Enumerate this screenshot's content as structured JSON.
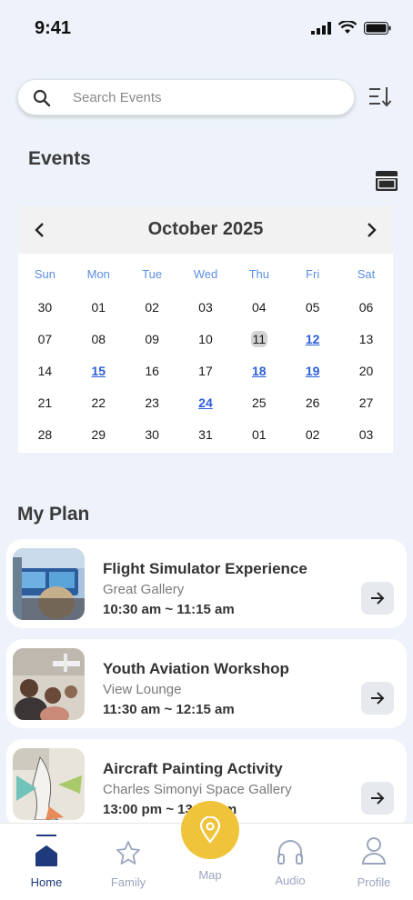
{
  "status": {
    "time": "9:41"
  },
  "search": {
    "placeholder": "Search Events",
    "value": ""
  },
  "events_section": {
    "title": "Events"
  },
  "calendar": {
    "month_label": "October 2025",
    "weekdays": [
      "Sun",
      "Mon",
      "Tue",
      "Wed",
      "Thu",
      "Fri",
      "Sat"
    ],
    "weeks": [
      [
        "30",
        "01",
        "02",
        "03",
        "04",
        "05",
        "06"
      ],
      [
        "07",
        "08",
        "09",
        "10",
        "11",
        "12",
        "13"
      ],
      [
        "14",
        "15",
        "16",
        "17",
        "18",
        "19",
        "20"
      ],
      [
        "21",
        "22",
        "23",
        "24",
        "25",
        "26",
        "27"
      ],
      [
        "28",
        "29",
        "30",
        "31",
        "01",
        "02",
        "03"
      ]
    ],
    "today": "11",
    "event_days": [
      "12",
      "15",
      "18",
      "19",
      "24"
    ]
  },
  "my_plan": {
    "title": "My Plan",
    "items": [
      {
        "name": "Flight Simulator Experience",
        "location": "Great Gallery",
        "time": "10:30 am ~ 11:15 am"
      },
      {
        "name": "Youth Aviation Workshop",
        "location": "View Lounge",
        "time": "11:30 am ~ 12:15 am"
      },
      {
        "name": "Aircraft Painting Activity",
        "location": "Charles Simonyi Space Gallery",
        "time": "13:00 pm ~ 13:45 pm"
      }
    ]
  },
  "tabs": {
    "home": "Home",
    "family": "Family",
    "map": "Map",
    "audio": "Audio",
    "profile": "Profile"
  },
  "colors": {
    "background": "#eef3fb",
    "accent_blue": "#2b5fd9",
    "weekday_blue": "#5b8ee0",
    "nav_active": "#1f3a7a",
    "map_button": "#f0c43a"
  }
}
